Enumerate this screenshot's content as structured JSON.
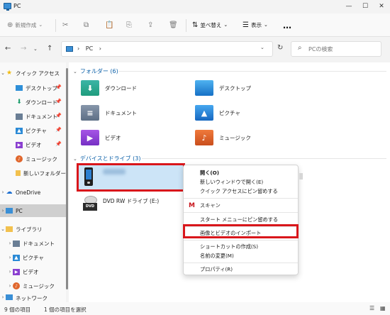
{
  "window": {
    "title": "PC",
    "minimize": "—",
    "maximize": "☐",
    "close": "✕"
  },
  "toolbar": {
    "new_label": "新規作成",
    "sort_label": "並べ替え",
    "view_label": "表示",
    "more_label": "…"
  },
  "address": {
    "path": "PC",
    "separator": "›",
    "search_placeholder": "PCの検索"
  },
  "sidebar": {
    "quick_access": "クイック アクセス",
    "quick_items": [
      "デスクトップ",
      "ダウンロード",
      "ドキュメント",
      "ピクチャ",
      "ビデオ",
      "ミュージック",
      "新しいフォルダー"
    ],
    "onedrive": "OneDrive",
    "pc": "PC",
    "library": "ライブラリ",
    "library_items": [
      "ドキュメント",
      "ピクチャ",
      "ビデオ",
      "ミュージック"
    ],
    "network": "ネットワーク"
  },
  "content": {
    "folders_header": "フォルダー (6)",
    "folders": [
      "ダウンロード",
      "デスクトップ",
      "ドキュメント",
      "ピクチャ",
      "ビデオ",
      "ミュージック"
    ],
    "drives_header": "デバイスとドライブ (3)",
    "dvd_label": "DVD RW ドライブ (E:)"
  },
  "context_menu": {
    "items": [
      "開く(O)",
      "新しいウィンドウで開く(E)",
      "クイック アクセスにピン留めする",
      "スキャン",
      "スタート メニューにピン留めする",
      "画像とビデオのインポート",
      "ショートカットの作成(S)",
      "名前の変更(M)",
      "プロパティ(R)"
    ]
  },
  "status": {
    "item_count": "9 個の項目",
    "selected": "1 個の項目を選択"
  },
  "colors": {
    "accent": "#0a5fa8",
    "selection": "#cce4f7",
    "highlight_box": "#d9161b"
  }
}
